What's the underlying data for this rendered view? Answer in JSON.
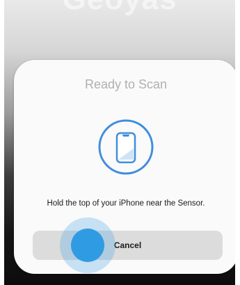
{
  "background": {
    "title": "Geoyas"
  },
  "scan_sheet": {
    "title": "Ready to Scan",
    "icon": "phone-scan-icon",
    "instruction": "Hold the top of your iPhone near the Sensor.",
    "cancel_label": "Cancel"
  },
  "colors": {
    "accent": "#3e8ede",
    "touch_indicator": "#2f9be3",
    "button_bg": "#dcdcdc"
  }
}
